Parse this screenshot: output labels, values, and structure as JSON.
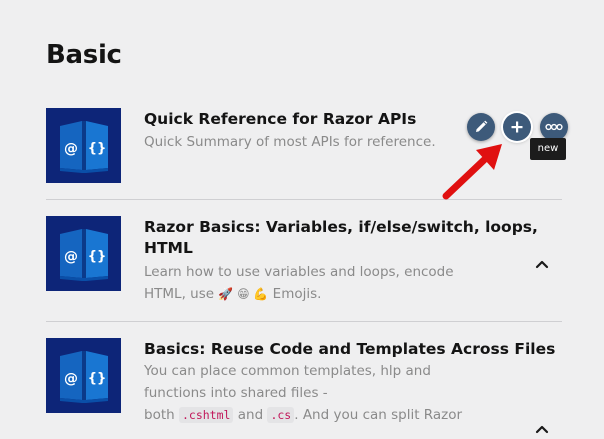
{
  "section": {
    "title": "Basic"
  },
  "items": [
    {
      "title": "Quick Reference for Razor APIs",
      "description": "Quick Summary of most APIs for reference."
    },
    {
      "title": "Razor Basics: Variables, if/else/switch, loops, HTML",
      "description_part1": "Learn how to use variables and loops, encode HTML, use",
      "emojis": "🚀 😁 💪",
      "description_part2": "Emojis."
    },
    {
      "title": "Basics: Reuse Code and Templates Across Files",
      "description_part1": "You can place common templates, hlp and functions into shared files -",
      "description_both": "both",
      "code1": ".cshtml",
      "description_and": "and",
      "code2": ".cs",
      "description_part2": ". And you can split Razor"
    }
  ],
  "thumbnail": {
    "symbol_at": "@",
    "symbol_braces": "{}",
    "background": "#0d2578",
    "book_color": "#1565c0"
  },
  "toolbar": {
    "edit_icon": "pencil-icon",
    "add_icon": "plus-icon",
    "more_icon": "more-icon",
    "button_color": "#3d5a7a",
    "tooltip": "new"
  },
  "annotation": {
    "arrow_color": "#e01010"
  },
  "icons": {
    "collapse": "chevron-up-icon"
  }
}
